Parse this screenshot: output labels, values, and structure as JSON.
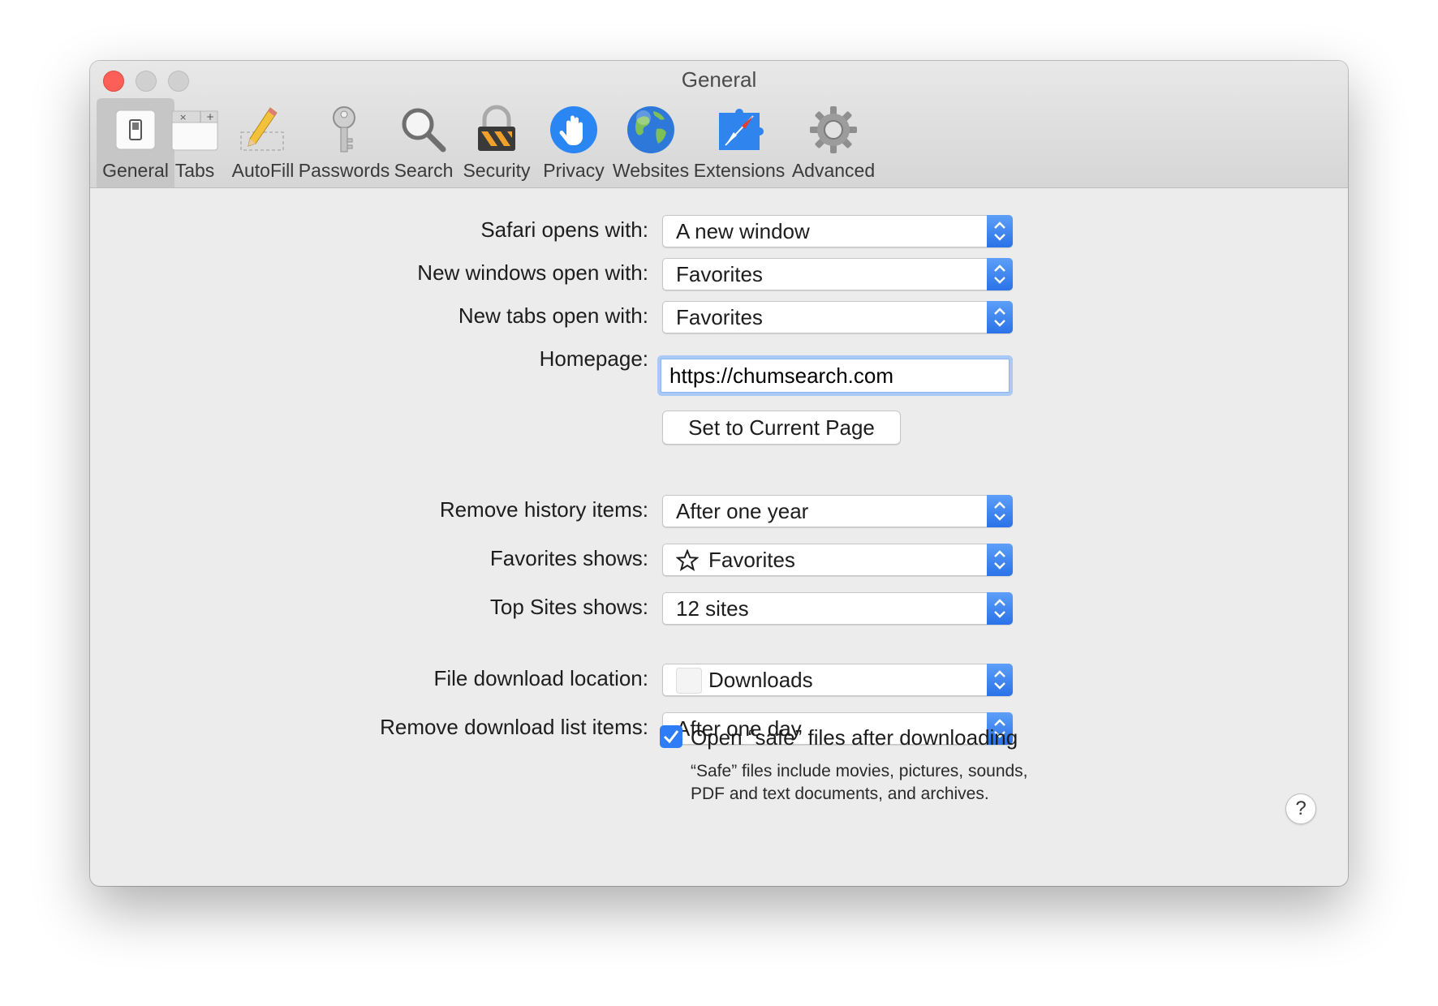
{
  "window": {
    "title": "General"
  },
  "toolbar": {
    "items": [
      {
        "label": "General",
        "icon": "general-switch-icon",
        "selected": true
      },
      {
        "label": "Tabs",
        "icon": "tabs-icon",
        "selected": false
      },
      {
        "label": "AutoFill",
        "icon": "pencil-icon",
        "selected": false
      },
      {
        "label": "Passwords",
        "icon": "key-icon",
        "selected": false
      },
      {
        "label": "Search",
        "icon": "magnifier-icon",
        "selected": false
      },
      {
        "label": "Security",
        "icon": "padlock-icon",
        "selected": false
      },
      {
        "label": "Privacy",
        "icon": "hand-icon",
        "selected": false
      },
      {
        "label": "Websites",
        "icon": "globe-icon",
        "selected": false
      },
      {
        "label": "Extensions",
        "icon": "compass-puzzle-icon",
        "selected": false
      },
      {
        "label": "Advanced",
        "icon": "gear-icon",
        "selected": false
      }
    ]
  },
  "general": {
    "safari_opens_with": {
      "label": "Safari opens with:",
      "value": "A new window"
    },
    "new_windows_open_with": {
      "label": "New windows open with:",
      "value": "Favorites"
    },
    "new_tabs_open_with": {
      "label": "New tabs open with:",
      "value": "Favorites"
    },
    "homepage": {
      "label": "Homepage:",
      "value": "https://chumsearch.com"
    },
    "set_current_page": "Set to Current Page",
    "remove_history_items": {
      "label": "Remove history items:",
      "value": "After one year"
    },
    "favorites_shows": {
      "label": "Favorites shows:",
      "value": "Favorites",
      "icon": "star-icon"
    },
    "top_sites_shows": {
      "label": "Top Sites shows:",
      "value": "12 sites"
    },
    "file_download_location": {
      "label": "File download location:",
      "value": "Downloads",
      "icon": "folder-icon"
    },
    "remove_download_list_items": {
      "label": "Remove download list items:",
      "value": "After one day"
    },
    "open_safe_files": {
      "checked": true,
      "label": "Open “safe” files after downloading",
      "help": "“Safe” files include movies, pictures, sounds, PDF and text documents, and archives."
    },
    "help_button": "?"
  },
  "colors": {
    "accent": "#2f7df6",
    "close": "#fc5f57",
    "window_bg": "#ececec"
  }
}
